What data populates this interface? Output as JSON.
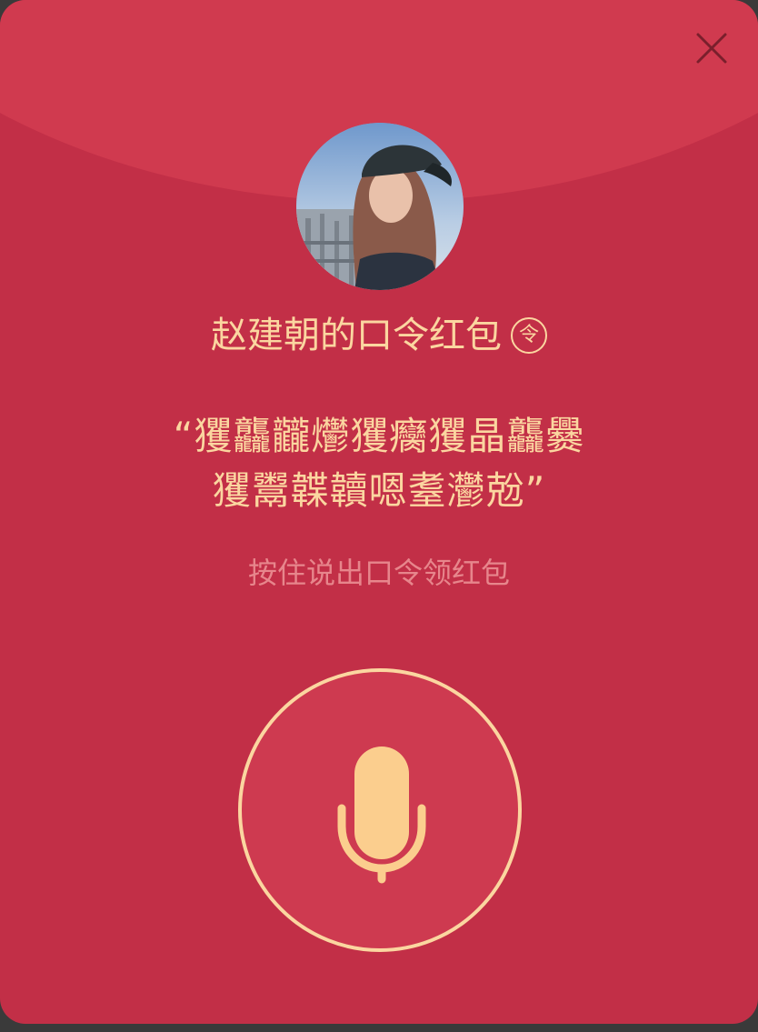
{
  "redpacket": {
    "title": "赵建朝的口令红包",
    "badge": "令",
    "password_line1": "“玃龘龖爩玃癵玃晶龘爨",
    "password_line2": "玃鬻韘韥嗯耋灪兝”",
    "hint": "按住说出口令领红包"
  },
  "icons": {
    "close": "close-icon",
    "mic": "microphone-icon",
    "avatar": "user-avatar-photo"
  },
  "colors": {
    "card_bg": "#c22f47",
    "dome_bg": "#d03a4f",
    "gold": "#fbd6a0",
    "hint": "#e7868c",
    "mic_fill": "#fbce8e"
  }
}
